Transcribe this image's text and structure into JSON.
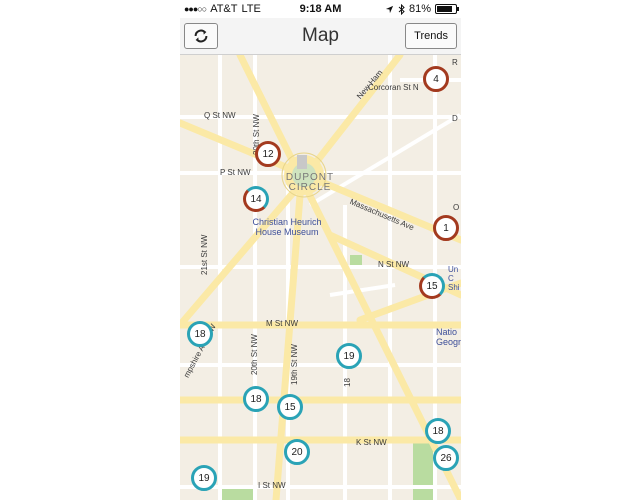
{
  "status_bar": {
    "carrier": "AT&T",
    "network": "LTE",
    "time": "9:18 AM",
    "battery": "81%",
    "battery_level": 0.81,
    "icons": [
      "signal-dots-icon",
      "location-arrow-icon",
      "bluetooth-icon",
      "battery-icon"
    ]
  },
  "navbar": {
    "title": "Map",
    "refresh_icon": "refresh-icon",
    "trends_label": "Trends"
  },
  "map": {
    "streets": {
      "q_st": "Q St NW",
      "p_st": "P St NW",
      "n_st": "N St NW",
      "m_st": "M St NW",
      "k_st": "K St NW",
      "i_st": "I St NW",
      "corcoran": "Corcoran St N",
      "st20_top": "20th St NW",
      "st20_bottom": "20th St NW",
      "st19": "19th St NW",
      "st18": "18",
      "st21": "21st St NW",
      "new_hamp_top": "New Ham",
      "new_hamp_bottom": "mpshire Ave NW",
      "mass_ave": "Massachusetts Ave"
    },
    "dupont_circle": "DUPONT\nCIRCLE",
    "poi_museum": "Christian Heurich\nHouse Museum",
    "poi_national_geo": "Natio\nGeographic",
    "edge_labels": {
      "r": "R",
      "o": "O",
      "united": "Un\nC\nShi",
      "d": "D"
    },
    "markers": [
      {
        "label": "4",
        "style": "red"
      },
      {
        "label": "12",
        "style": "red"
      },
      {
        "label": "14",
        "style": "half"
      },
      {
        "label": "1",
        "style": "red"
      },
      {
        "label": "15",
        "style": "half"
      },
      {
        "label": "18",
        "style": "teal"
      },
      {
        "label": "19",
        "style": "teal"
      },
      {
        "label": "18",
        "style": "teal"
      },
      {
        "label": "15",
        "style": "teal"
      },
      {
        "label": "18",
        "style": "teal"
      },
      {
        "label": "20",
        "style": "teal"
      },
      {
        "label": "26",
        "style": "teal"
      },
      {
        "label": "19",
        "style": "teal"
      }
    ],
    "colors": {
      "land": "#f3eee4",
      "major_road": "#fbe9a6",
      "minor_road": "#ffffff",
      "park": "#b9dca0",
      "marker_teal": "#2aa3b6",
      "marker_red": "#a33a1f"
    }
  }
}
